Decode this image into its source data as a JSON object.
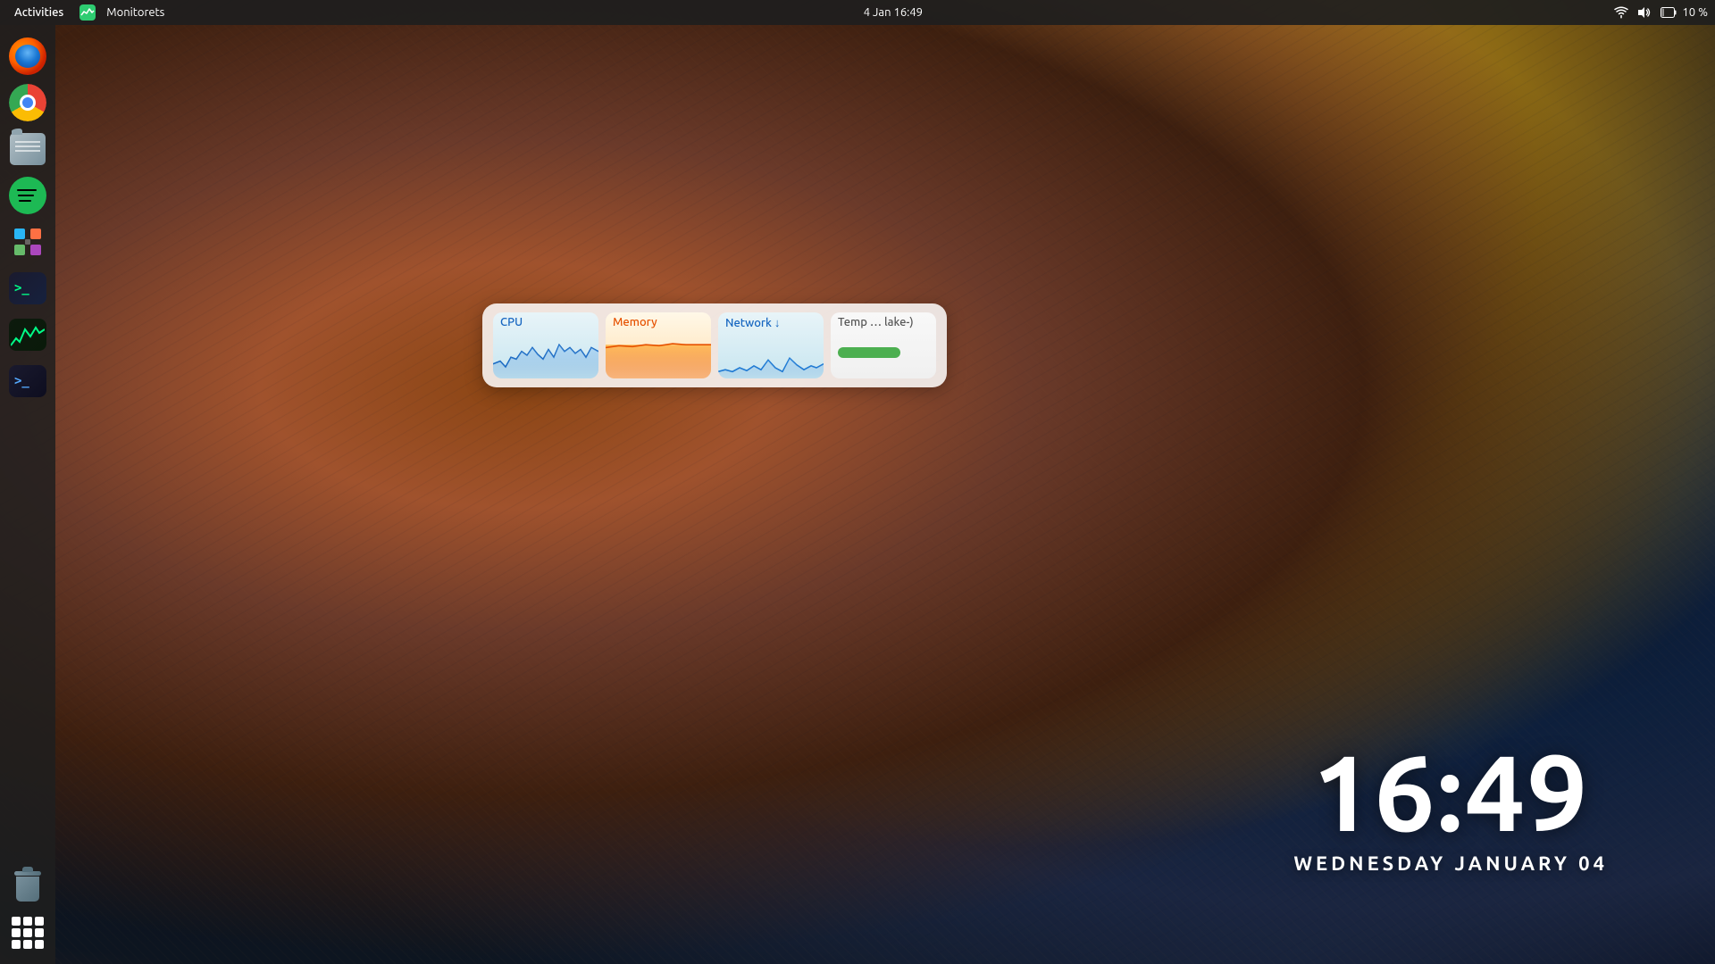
{
  "topbar": {
    "activities_label": "Activities",
    "app_icon": "monitorets-icon",
    "app_name": "Monitorets",
    "datetime": "4 Jan  16:49",
    "tray": {
      "wifi_icon": "▾",
      "volume_icon": "🔊",
      "battery_icon": "🔋",
      "battery_text": "10 %"
    }
  },
  "dock": {
    "items": [
      {
        "id": "firefox",
        "label": "Firefox"
      },
      {
        "id": "chrome",
        "label": "Google Chrome"
      },
      {
        "id": "files",
        "label": "Files"
      },
      {
        "id": "spotify",
        "label": "Spotify"
      },
      {
        "id": "puzzle",
        "label": "Puzzle"
      },
      {
        "id": "terminal",
        "label": "Terminal"
      },
      {
        "id": "sysmon",
        "label": "System Monitor"
      },
      {
        "id": "terminal2",
        "label": "Terminal"
      },
      {
        "id": "trash",
        "label": "Trash"
      },
      {
        "id": "grid",
        "label": "App Grid"
      }
    ]
  },
  "widgets": [
    {
      "id": "cpu",
      "label": "CPU",
      "type": "line",
      "color": "#1565c0",
      "bg_start": "#e8f4f8",
      "bg_end": "#c8e6f0"
    },
    {
      "id": "memory",
      "label": "Memory",
      "type": "fill",
      "color": "#e65100",
      "bg_start": "#fff8e8",
      "bg_end": "#ffe0b2"
    },
    {
      "id": "network",
      "label": "Network ↓",
      "type": "line",
      "color": "#1565c0",
      "bg_start": "#e8f4f8",
      "bg_end": "#c8e6f0"
    },
    {
      "id": "temp",
      "label": "Temp … lake-)",
      "type": "bar",
      "color": "#4caf50",
      "bg_start": "#f8f8f8",
      "bg_end": "#f0f0f0",
      "bar_width_pct": 60
    }
  ],
  "clock": {
    "time": "16:49",
    "date": "WEDNESDAY JANUARY 04"
  }
}
